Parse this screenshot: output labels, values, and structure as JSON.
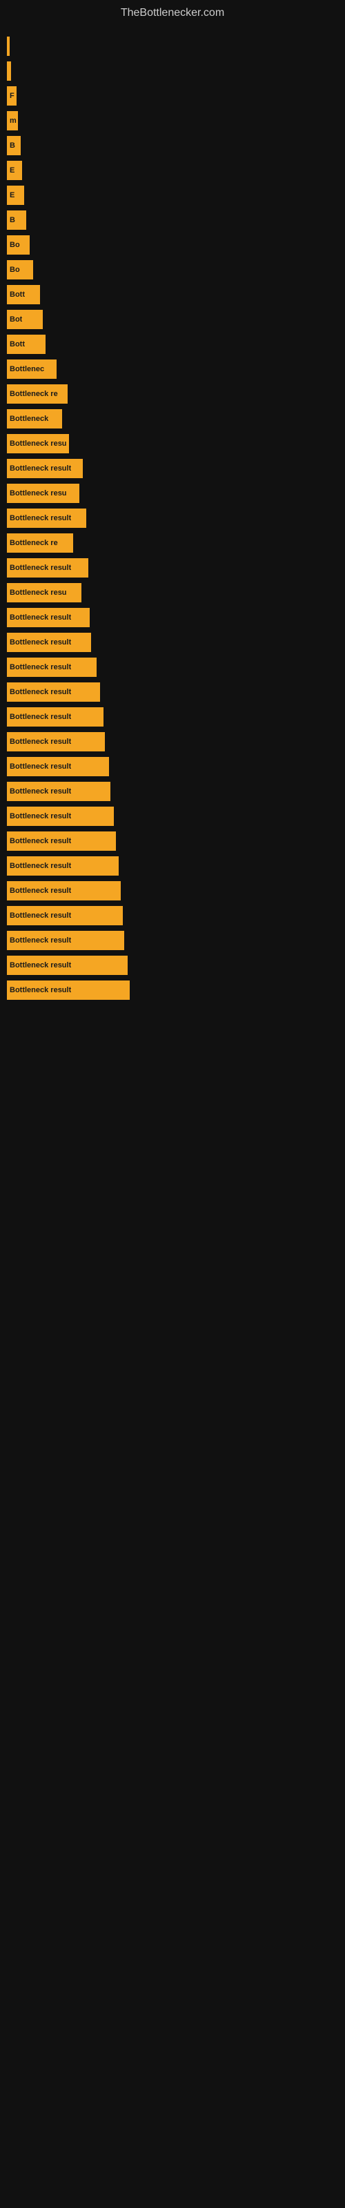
{
  "site": {
    "title": "TheBottlenecker.com"
  },
  "bars": [
    {
      "width": 4,
      "label": ""
    },
    {
      "width": 6,
      "label": ""
    },
    {
      "width": 14,
      "label": "F"
    },
    {
      "width": 16,
      "label": "m"
    },
    {
      "width": 20,
      "label": "B"
    },
    {
      "width": 22,
      "label": "E"
    },
    {
      "width": 25,
      "label": "E"
    },
    {
      "width": 28,
      "label": "B"
    },
    {
      "width": 33,
      "label": "Bo"
    },
    {
      "width": 38,
      "label": "Bo"
    },
    {
      "width": 48,
      "label": "Bott"
    },
    {
      "width": 52,
      "label": "Bot"
    },
    {
      "width": 56,
      "label": "Bott"
    },
    {
      "width": 72,
      "label": "Bottlenec"
    },
    {
      "width": 88,
      "label": "Bottleneck re"
    },
    {
      "width": 80,
      "label": "Bottleneck"
    },
    {
      "width": 90,
      "label": "Bottleneck resu"
    },
    {
      "width": 110,
      "label": "Bottleneck result"
    },
    {
      "width": 105,
      "label": "Bottleneck resu"
    },
    {
      "width": 115,
      "label": "Bottleneck result"
    },
    {
      "width": 96,
      "label": "Bottleneck re"
    },
    {
      "width": 118,
      "label": "Bottleneck result"
    },
    {
      "width": 108,
      "label": "Bottleneck resu"
    },
    {
      "width": 120,
      "label": "Bottleneck result"
    },
    {
      "width": 122,
      "label": "Bottleneck result"
    },
    {
      "width": 130,
      "label": "Bottleneck result"
    },
    {
      "width": 135,
      "label": "Bottleneck result"
    },
    {
      "width": 140,
      "label": "Bottleneck result"
    },
    {
      "width": 142,
      "label": "Bottleneck result"
    },
    {
      "width": 148,
      "label": "Bottleneck result"
    },
    {
      "width": 150,
      "label": "Bottleneck result"
    },
    {
      "width": 155,
      "label": "Bottleneck result"
    },
    {
      "width": 158,
      "label": "Bottleneck result"
    },
    {
      "width": 162,
      "label": "Bottleneck result"
    },
    {
      "width": 165,
      "label": "Bottleneck result"
    },
    {
      "width": 168,
      "label": "Bottleneck result"
    },
    {
      "width": 170,
      "label": "Bottleneck result"
    },
    {
      "width": 175,
      "label": "Bottleneck result"
    },
    {
      "width": 178,
      "label": "Bottleneck result"
    }
  ]
}
